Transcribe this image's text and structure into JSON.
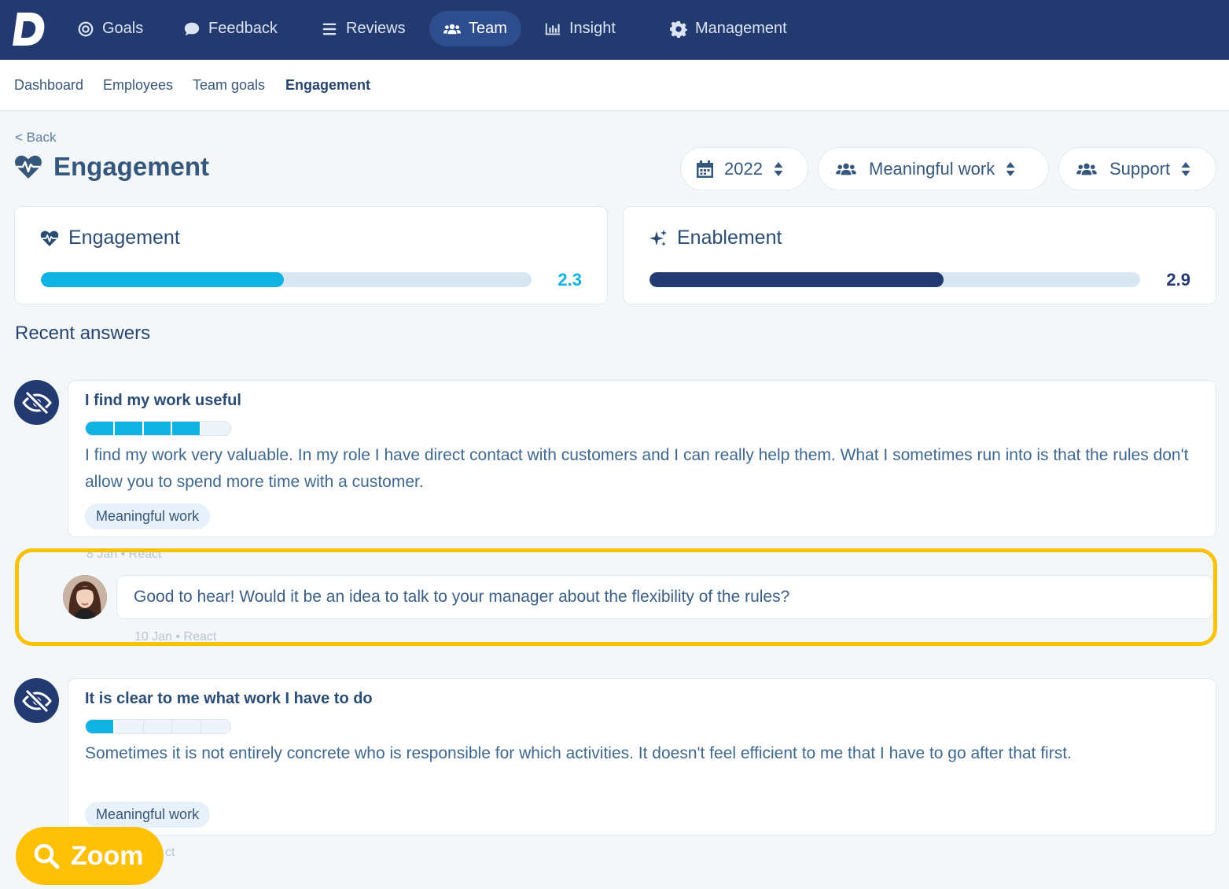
{
  "nav": {
    "items": [
      {
        "label": "Goals",
        "icon": "target-icon"
      },
      {
        "label": "Feedback",
        "icon": "speech-bubble-icon"
      },
      {
        "label": "Reviews",
        "icon": "list-icon"
      },
      {
        "label": "Team",
        "icon": "users-icon",
        "active": true
      },
      {
        "label": "Insight",
        "icon": "bar-chart-icon"
      },
      {
        "label": "Management",
        "icon": "gear-icon"
      }
    ]
  },
  "subnav": {
    "items": [
      "Dashboard",
      "Employees",
      "Team goals",
      "Engagement"
    ],
    "active": "Engagement"
  },
  "page": {
    "back": "< Back",
    "title": "Engagement"
  },
  "filters": {
    "year": "2022",
    "theme": "Meaningful work",
    "subtheme": "Support"
  },
  "scores": [
    {
      "label": "Engagement",
      "value": "2.3",
      "fill_fraction": 0.495,
      "color": "#0fb2e0",
      "icon": "heart-pulse-icon"
    },
    {
      "label": "Enablement",
      "value": "2.9",
      "fill_fraction": 0.6,
      "color": "#233a71",
      "icon": "sparkle-icon"
    }
  ],
  "recent": {
    "title": "Recent answers",
    "answers": [
      {
        "question": "I find my work useful",
        "rating": 4,
        "rating_max": 5,
        "text": "I find my work very valuable. In my role I have direct contact with customers and I can really help them. What I sometimes run into is that the rules don't allow you to spend more time with a customer.",
        "tag": "Meaningful work",
        "meta": "8 Jan • React",
        "reply": {
          "text": "Good to hear! Would it be an idea to talk to your manager about the flexibility of the rules?",
          "meta": "10 Jan • React"
        }
      },
      {
        "question": "It is clear to me what work I have to do",
        "rating": 1,
        "rating_max": 5,
        "text": "Sometimes it is not entirely concrete who is responsible for which activities. It doesn't feel efficient to me that I have to go after that first.",
        "tag": "Meaningful work",
        "meta": "ct"
      }
    ]
  },
  "zoom": {
    "label": "Zoom"
  },
  "colors": {
    "navbar": "#233a71",
    "accent_cyan": "#0fb2e0",
    "highlight": "#f8c209",
    "zoom": "#ffc107"
  }
}
